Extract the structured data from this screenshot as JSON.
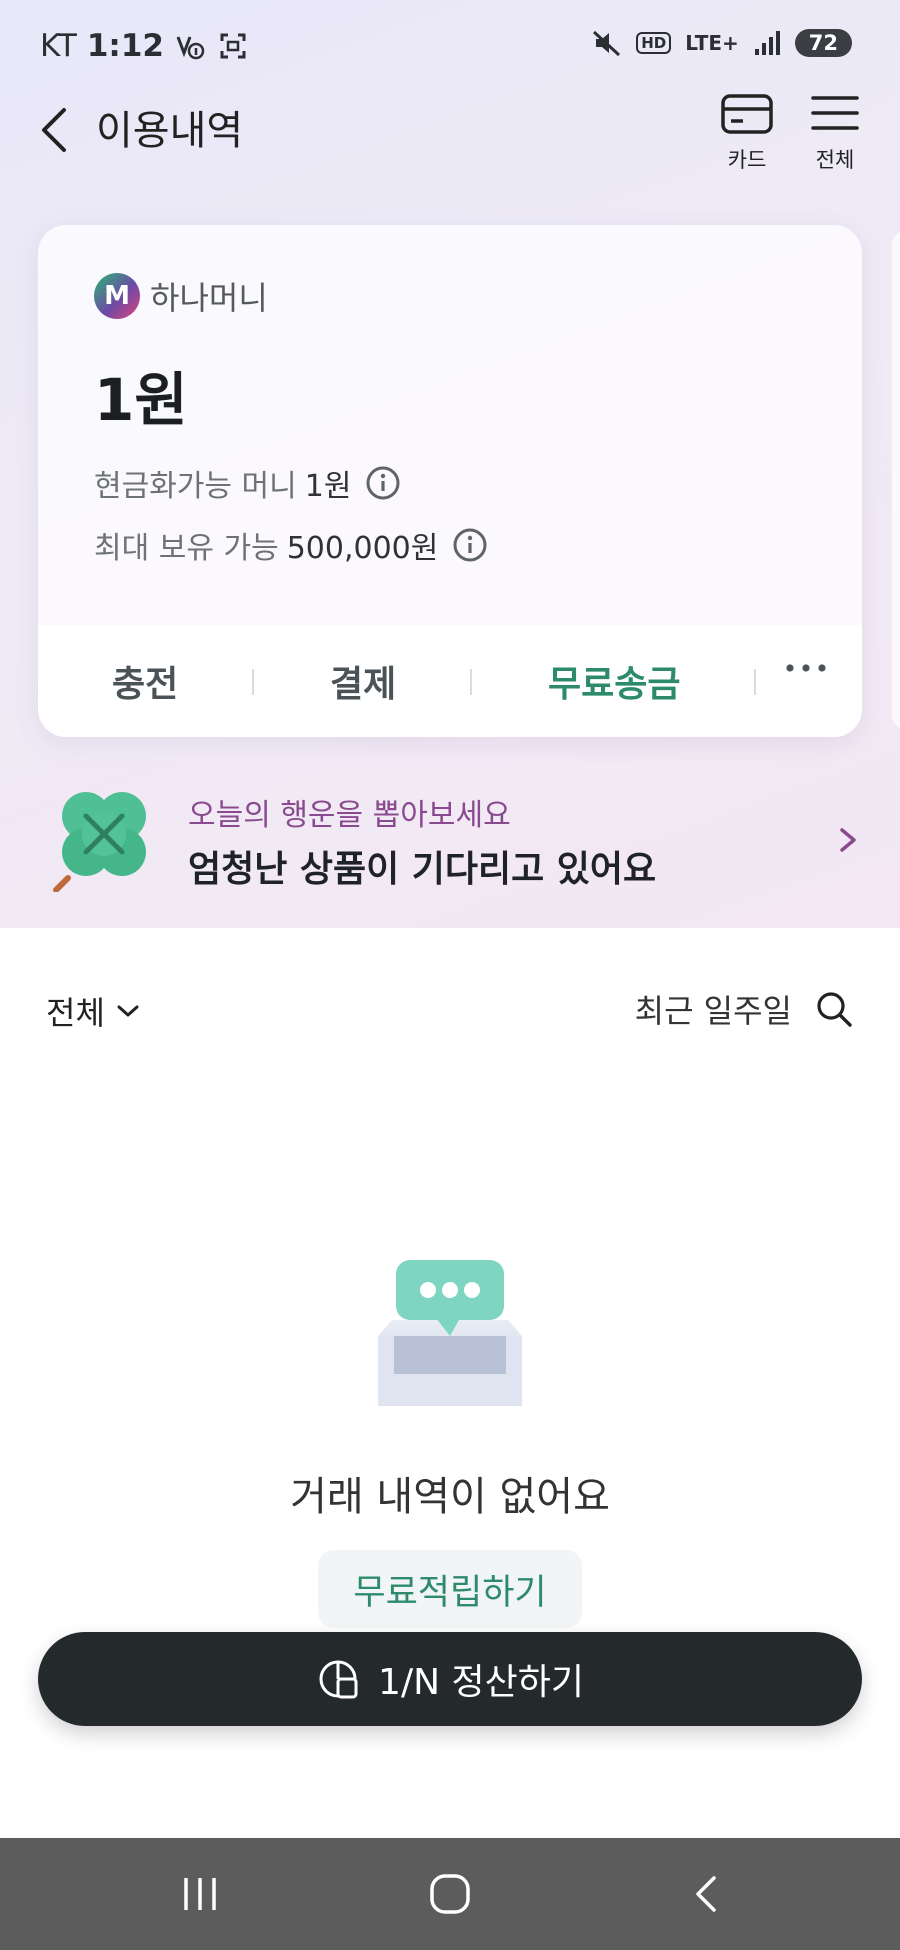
{
  "status_bar": {
    "carrier": "KT",
    "time": "1:12",
    "network": "LTE+",
    "hd": "HD",
    "battery": "72"
  },
  "header": {
    "title": "이용내역",
    "card_label": "카드",
    "menu_label": "전체"
  },
  "card": {
    "brand_logo_letter": "M",
    "brand_name": "하나머니",
    "balance": "1원",
    "cashable_label": "현금화가능 머니",
    "cashable_value": "1원",
    "max_label": "최대 보유 가능",
    "max_value": "500,000원",
    "actions": {
      "charge": "충전",
      "pay": "결제",
      "free_transfer": "무료송금"
    }
  },
  "promo": {
    "subtitle": "오늘의 행운을 뽑아보세요",
    "title": "엄청난 상품이 기다리고 있어요"
  },
  "filter": {
    "type": "전체",
    "period": "최근 일주일"
  },
  "empty": {
    "message": "거래 내역이 없어요",
    "earn_button": "무료적립하기"
  },
  "split_button": "1/N 정산하기",
  "colors": {
    "accent_green": "#2e8a6c",
    "promo_purple": "#8a4a8f",
    "dark_button": "#24292b",
    "nav_bar": "#5c5c5c"
  },
  "icons": [
    "back-icon",
    "card-icon",
    "menu-icon",
    "info-icon",
    "more-icon",
    "clover-icon",
    "chevron-right-icon",
    "chevron-down-icon",
    "search-icon",
    "inbox-icon",
    "split-icon",
    "recent-apps-icon",
    "home-icon",
    "nav-back-icon"
  ]
}
